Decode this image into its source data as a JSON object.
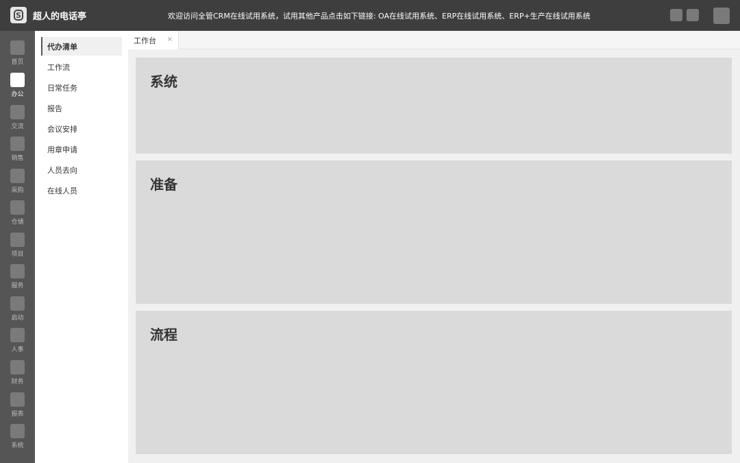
{
  "header": {
    "app_title": "超人的电话亭",
    "logo_icon": "s-logo-icon",
    "announcement": "欢迎访问全管CRM在线试用系统，试用其他产品点击如下链接: OA在线试用系统、ERP在线试用系统、ERP+生产在线试用系统"
  },
  "rail": {
    "items": [
      {
        "label": "首页"
      },
      {
        "label": "办公"
      },
      {
        "label": "交流"
      },
      {
        "label": "销售"
      },
      {
        "label": "采购"
      },
      {
        "label": "仓储"
      },
      {
        "label": "项目"
      },
      {
        "label": "服务"
      },
      {
        "label": "启动"
      },
      {
        "label": "人事"
      },
      {
        "label": "财务"
      },
      {
        "label": "报表"
      },
      {
        "label": "系统"
      }
    ],
    "active_index": 1
  },
  "submenu": {
    "items": [
      {
        "label": "代办清单"
      },
      {
        "label": "工作流"
      },
      {
        "label": "日常任务"
      },
      {
        "label": "报告"
      },
      {
        "label": "会议安排"
      },
      {
        "label": "用章申请"
      },
      {
        "label": "人员去向"
      },
      {
        "label": "在线人员"
      }
    ],
    "active_index": 0
  },
  "tabs": [
    {
      "label": "工作台",
      "close": "×"
    }
  ],
  "panels": [
    {
      "title": "系统"
    },
    {
      "title": "准备"
    },
    {
      "title": "流程"
    }
  ],
  "colors": {
    "topbar": "#3e3e3e",
    "rail": "#555555",
    "panel": "#dadada"
  }
}
